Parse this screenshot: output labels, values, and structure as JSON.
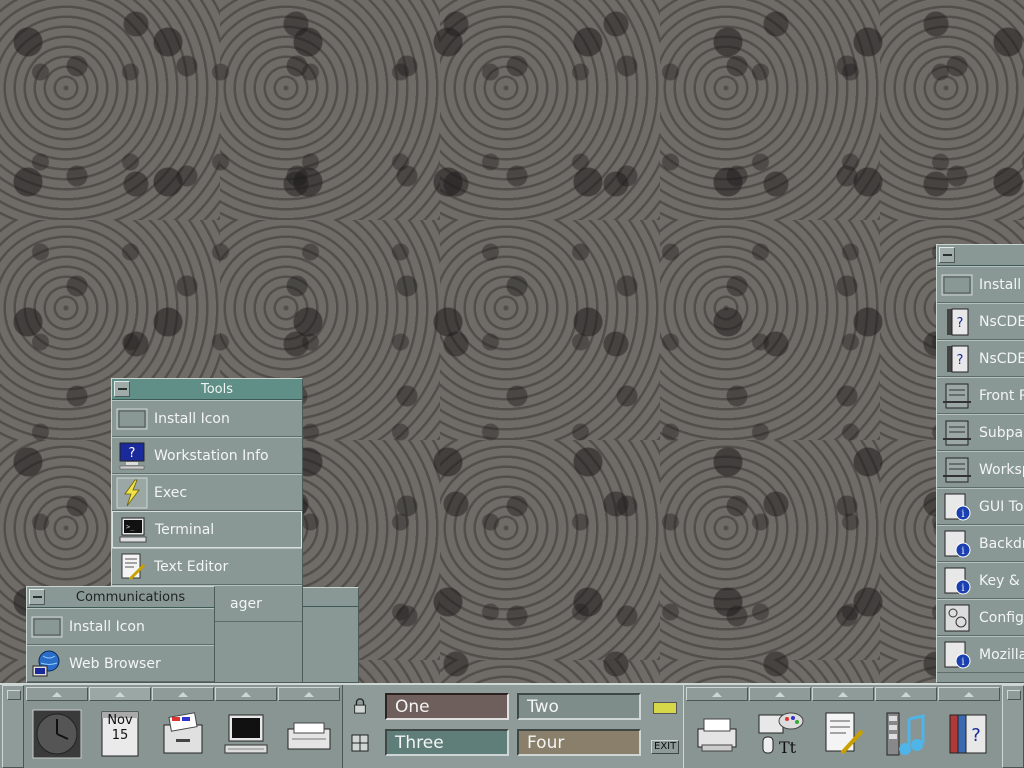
{
  "tools_panel": {
    "title": "Tools",
    "items": [
      {
        "label": "Install Icon",
        "icon": "install-icon"
      },
      {
        "label": "Workstation Info",
        "icon": "workstation-info-icon"
      },
      {
        "label": "Exec",
        "icon": "lightning-icon"
      },
      {
        "label": "Terminal",
        "icon": "terminal-icon"
      },
      {
        "label": "Text Editor",
        "icon": "text-editor-icon"
      },
      {
        "label": "ager",
        "icon": "app-manager-icon"
      }
    ]
  },
  "communications_panel": {
    "title": "Communications",
    "items": [
      {
        "label": "Install Icon",
        "icon": "install-icon"
      },
      {
        "label": "Web Browser",
        "icon": "web-browser-icon"
      }
    ]
  },
  "right_panel": {
    "items": [
      {
        "label": "Install",
        "icon": "install-icon"
      },
      {
        "label": "NsCDE",
        "icon": "help-book-icon"
      },
      {
        "label": "NsCDE",
        "icon": "help-book-icon"
      },
      {
        "label": "Front P",
        "icon": "front-panel-icon"
      },
      {
        "label": "Subpan",
        "icon": "subpanel-icon"
      },
      {
        "label": "Worksp",
        "icon": "workspace-icon"
      },
      {
        "label": "GUI To",
        "icon": "info-doc-icon"
      },
      {
        "label": "Backdr",
        "icon": "info-doc-icon"
      },
      {
        "label": "Key &",
        "icon": "info-doc-icon"
      },
      {
        "label": "Configu",
        "icon": "config-icon"
      },
      {
        "label": "Mozilla",
        "icon": "info-doc-icon"
      }
    ]
  },
  "front_panel": {
    "calendar": {
      "month": "Nov",
      "day": "15"
    },
    "workspaces": [
      "One",
      "Two",
      "Three",
      "Four"
    ],
    "active_workspace": "One",
    "exit_label": "EXIT",
    "colors": {
      "ws_one": "#6f5f5c",
      "ws_two": "#7f8d8a",
      "ws_three": "#5f7e79",
      "ws_four": "#8a7f6a"
    }
  }
}
